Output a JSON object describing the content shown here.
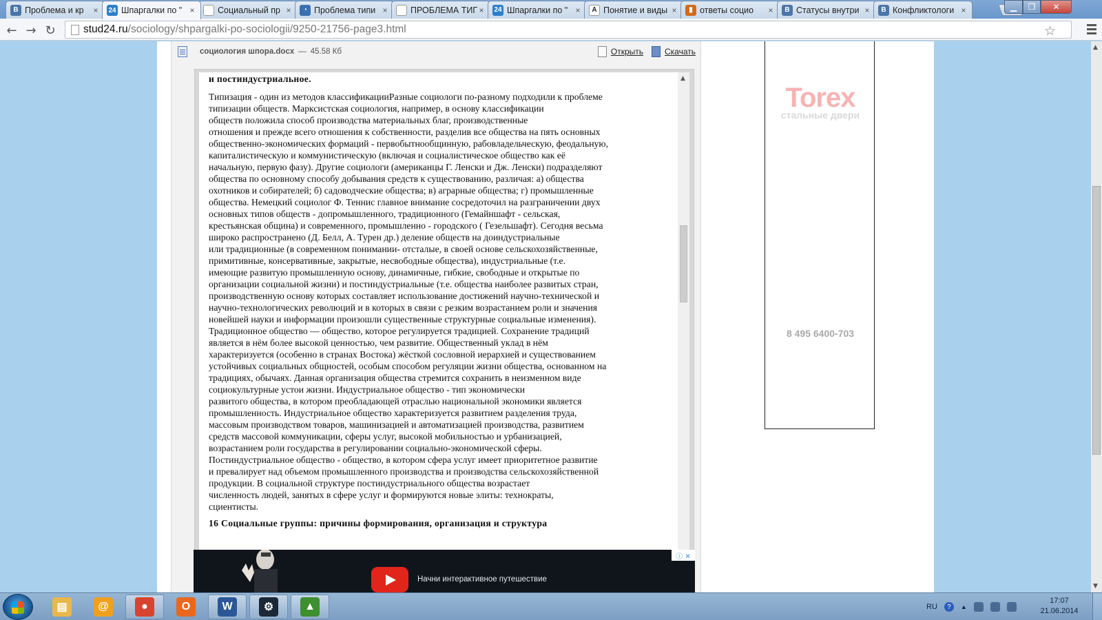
{
  "browser": {
    "tabs": [
      {
        "title": "Проблема и кр",
        "favicon": "vk-icon",
        "color": "#4a76a8",
        "glyph": "В",
        "active": false
      },
      {
        "title": "Шпаргалки по \"",
        "favicon": "stud24-icon",
        "color": "#2f7fc8",
        "glyph": "24",
        "active": true
      },
      {
        "title": "Социальный пр",
        "favicon": "page-icon",
        "color": "#ffffff",
        "glyph": "",
        "active": false
      },
      {
        "title": "Проблема типи",
        "favicon": "globe-icon",
        "color": "#3a6fb0",
        "glyph": "◔",
        "active": false
      },
      {
        "title": "ПРОБЛЕМА ТИП",
        "favicon": "page-icon",
        "color": "#ffffff",
        "glyph": "",
        "active": false
      },
      {
        "title": "Шпаргалки по \"",
        "favicon": "stud24-icon",
        "color": "#2f7fc8",
        "glyph": "24",
        "active": false
      },
      {
        "title": "Понятие и виды",
        "favicon": "a-letter-icon",
        "color": "#ffffff",
        "glyph": "A",
        "active": false
      },
      {
        "title": "ответы социо",
        "favicon": "book-icon",
        "color": "#d06a1c",
        "glyph": "▮",
        "active": false
      },
      {
        "title": "Статусы внутри",
        "favicon": "vk-icon",
        "color": "#4a76a8",
        "glyph": "В",
        "active": false
      },
      {
        "title": "Конфликтологи",
        "favicon": "vk-icon",
        "color": "#4a76a8",
        "glyph": "В",
        "active": false
      }
    ],
    "close_glyph": "×",
    "url_host": "stud24.ru",
    "url_path": "/sociology/shpargalki-po-sociologii/9250-21756-page3.html"
  },
  "file": {
    "name": "социология шпора.docx",
    "separator": "—",
    "size": "45.58 Кб",
    "open_label": "Открыть",
    "download_label": "Скачать"
  },
  "document": {
    "heading_top": "и постиндустриальное.",
    "lines": [
      "Типизация - один из методов классификацииРазные  социологи по-разному подходили  к проблеме",
      "типизации обществ. Марксистская социология, например, в основу классификации",
      "обществ положила способ производства материальных благ, производственные",
      "отношения и прежде всего отношения  к собственности, разделив все общества на пять основных",
      "общественно-экономических  формаций - первобытнообщинную, рабовладельческую, феодальную,",
      "капиталистическую и  коммунистическую (включая и социалистическое общество как её",
      "начальную, первую фазу). Другие социологи (американцы Г. Ленски и Дж. Ленски) подразделяют",
      "общества по основному способу добывания  средств к существованию, различая: а) общества",
      "охотников и собирателей; б) садоводческие общества; в) аграрные общества; г) промышленные",
      "общества. Немецкий социолог Ф. Теннис главное внимание сосредоточил на разграничении двух",
      "основных типов обществ - допромышленного, традиционного (Гемайншафт - сельская,",
      "крестьянская община) и современного, промышленно - городского ( Гезельшафт).  Сегодня весьма",
      "широко распространено (Д. Белл, А. Турен др.) деление обществ  на доиндустриальные",
      "или традиционные (в современном понимании- отсталые, в своей основе сельскохозяйственные,",
      "примитивные, консервативные, закрытые, несвободные общества), индустриальные (т.е.",
      "имеющие развитую промышленную основу, динамичные, гибкие, свободные  и открытые по",
      "организации социальной жизни) и постиндустриальные (т.е. общества наиболее развитых стран,",
      "производственную основу которых составляет использование  достижений научно-технической и",
      "научно-технологических революций  и в которых в связи с  резким возрастанием роли и значения",
      "новейшей науки и информации произошли  существенные структурные социальные изменения).",
      "Традиционное общество —  общество, которое регулируется традицией. Сохранение традиций",
      "является в нём  более высокой ценностью, чем  развитие. Общественный уклад в нём",
      "характеризуется (особенно в странах  Востока) жёсткой сословной иерархией  и существованием",
      "устойчивых социальных общностей, особым способом регуляции  жизни общества, основанном на",
      "традициях, обычаях. Данная организация общества стремится сохранить в неизменном виде",
      "социокультурные устои жизни. Индустриальное общество - тип экономически",
      "развитого общества, в котором  преобладающей отраслью национальной экономики является",
      "промышленность. Индустриальное общество характеризуется  развитием разделения труда,",
      "массовым производством товаров, машинизацией и автоматизацией производства, развитием",
      "средств массовой коммуникации, сферы  услуг, высокой мобильностью и урбанизацией,",
      "возрастанием роли государства в  регулировании социально-экономической  сферы.",
      "Постиндустриальное общество - общество, в котором сфера услуг  имеет приоритетное развитие",
      "и превалирует  над объемом промышленного производства и производства сельскохозяйственной",
      "продукции. В социальной структуре  постиндустриального общества возрастает",
      "численность людей, занятых в  сфере услуг и формируются  новые элиты: технократы,",
      "сциентисты."
    ],
    "heading_bottom": "16 Социальные группы: причины формирования, организация и  структура"
  },
  "ads": {
    "right_brand": "Torex",
    "right_tagline": "стальные двери",
    "right_phone": "8 495 6400-703",
    "bottom_text": "Начни интерактивное путешествие",
    "bottom_choices": "ⓘ ✕"
  },
  "taskbar": {
    "apps": [
      {
        "name": "explorer",
        "icon": "folder-icon",
        "color": "#e8b84a",
        "glyph": "▤",
        "open": false
      },
      {
        "name": "mail-agent",
        "icon": "at-mail-icon",
        "color": "#f0a020",
        "glyph": "@",
        "open": false
      },
      {
        "name": "chrome",
        "icon": "chrome-icon",
        "color": "#d8432f",
        "glyph": "●",
        "open": true
      },
      {
        "name": "opera",
        "icon": "orange-o-icon",
        "color": "#e86820",
        "glyph": "O",
        "open": false
      },
      {
        "name": "word",
        "icon": "word-icon",
        "color": "#2b5797",
        "glyph": "W",
        "open": true
      },
      {
        "name": "steam",
        "icon": "steam-icon",
        "color": "#1b2838",
        "glyph": "⚙",
        "open": true
      },
      {
        "name": "game",
        "icon": "triangle-game-icon",
        "color": "#3d8f2f",
        "glyph": "▲",
        "open": true
      }
    ],
    "language": "RU",
    "help_glyph": "?",
    "time": "17:07",
    "date": "21.06.2014"
  }
}
